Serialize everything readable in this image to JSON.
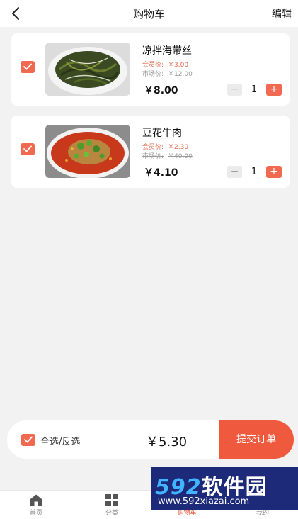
{
  "header": {
    "title": "购物车",
    "edit_label": "编辑"
  },
  "items": [
    {
      "name": "凉拌海带丝",
      "member_label": "会员价:",
      "member_price": "￥3.00",
      "market_label": "市场价:",
      "market_price": "￥12.00",
      "price": "￥8.00",
      "qty": "1",
      "minus": "−",
      "plus": "+",
      "checked": true
    },
    {
      "name": "豆花牛肉",
      "member_label": "会员价:",
      "member_price": "￥2.30",
      "market_label": "市场价:",
      "market_price": "￥40.00",
      "price": "￥4.10",
      "qty": "1",
      "minus": "−",
      "plus": "+",
      "checked": true
    }
  ],
  "checkout": {
    "select_all_label": "全选/反选",
    "total": "￥5.30",
    "submit_label": "提交订单"
  },
  "tabs": [
    {
      "label": "首页",
      "icon": "home-icon"
    },
    {
      "label": "分类",
      "icon": "grid-icon"
    },
    {
      "label": "购物车",
      "icon": "cart-icon",
      "active": true
    },
    {
      "label": "我的",
      "icon": "user-icon"
    }
  ],
  "watermark": {
    "brand_num": "592",
    "brand_cn": "软件园",
    "url": "www.592xiazai.com"
  },
  "colors": {
    "accent": "#f06950",
    "submit": "#ef5a3e",
    "background": "#f2f2f2"
  }
}
